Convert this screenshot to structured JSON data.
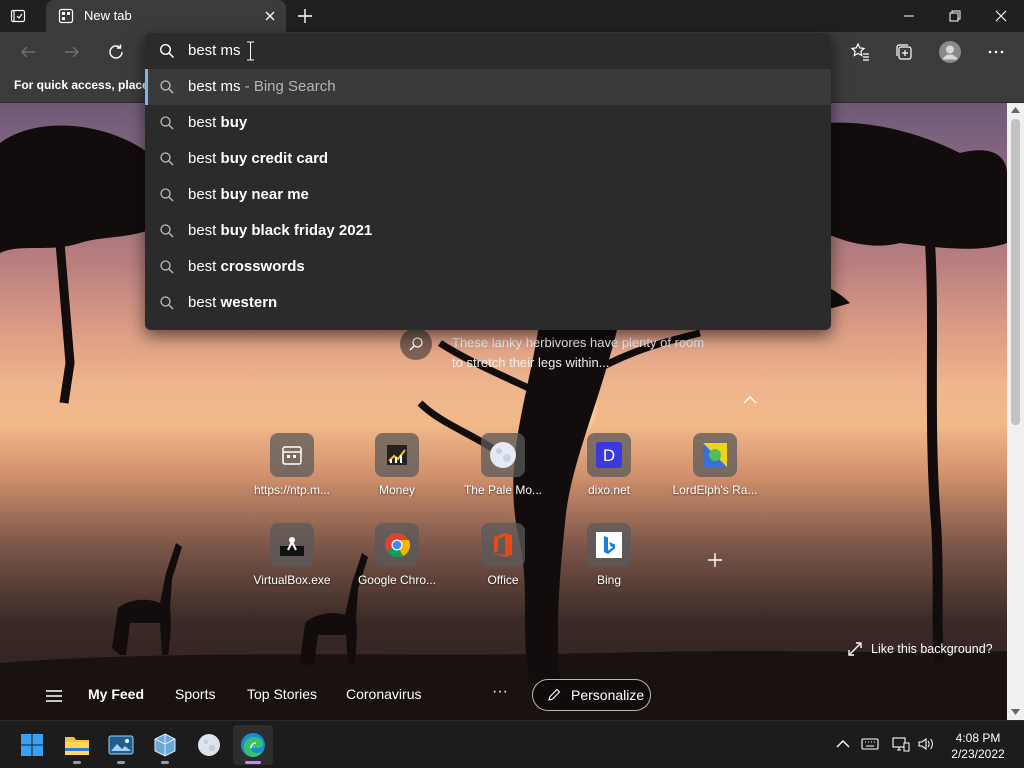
{
  "tab": {
    "title": "New tab"
  },
  "address": {
    "typed": "best ms"
  },
  "favorites_bar": {
    "hint": "For quick access, place y"
  },
  "suggestions": [
    {
      "plain": "best ms",
      "bold": "",
      "suffix": " - Bing Search",
      "selected": true
    },
    {
      "plain": "best ",
      "bold": "buy",
      "suffix": ""
    },
    {
      "plain": "best ",
      "bold": "buy credit card",
      "suffix": ""
    },
    {
      "plain": "best ",
      "bold": "buy near me",
      "suffix": ""
    },
    {
      "plain": "best ",
      "bold": "buy black friday 2021",
      "suffix": ""
    },
    {
      "plain": "best ",
      "bold": "crosswords",
      "suffix": ""
    },
    {
      "plain": "best ",
      "bold": "western",
      "suffix": ""
    }
  ],
  "ntp": {
    "caption": "These lanky herbivores have plenty of room to stretch their legs within...",
    "like_background": "Like this background?",
    "tiles": [
      {
        "label": "https://ntp.m...",
        "icon": "calendar-icon"
      },
      {
        "label": "Money",
        "icon": "money-chart-icon"
      },
      {
        "label": "The Pale Mo...",
        "icon": "pale-moon-icon"
      },
      {
        "label": "dixo.net",
        "icon": "dixo-d-icon"
      },
      {
        "label": "LordElph's Ra...",
        "icon": "lordelph-icon"
      },
      {
        "label": "VirtualBox.exe",
        "icon": "virtualbox-exe-icon"
      },
      {
        "label": "Google Chro...",
        "icon": "chrome-icon"
      },
      {
        "label": "Office",
        "icon": "office-icon"
      },
      {
        "label": "Bing",
        "icon": "bing-icon"
      }
    ],
    "feed": {
      "items": [
        "My Feed",
        "Sports",
        "Top Stories",
        "Coronavirus"
      ],
      "more": "···",
      "personalize": "Personalize"
    }
  },
  "taskbar": {
    "time": "4:08 PM",
    "date": "2/23/2022",
    "apps": [
      "start-windows-icon",
      "file-explorer-icon",
      "photos-icon",
      "virtualbox-icon",
      "pale-moon-icon",
      "edge-icon"
    ]
  },
  "colors": {
    "accent": "#76b9ed",
    "edge_indicator": "#c488f2",
    "titlebar": "#202020",
    "toolbar": "#3b3b3b"
  }
}
